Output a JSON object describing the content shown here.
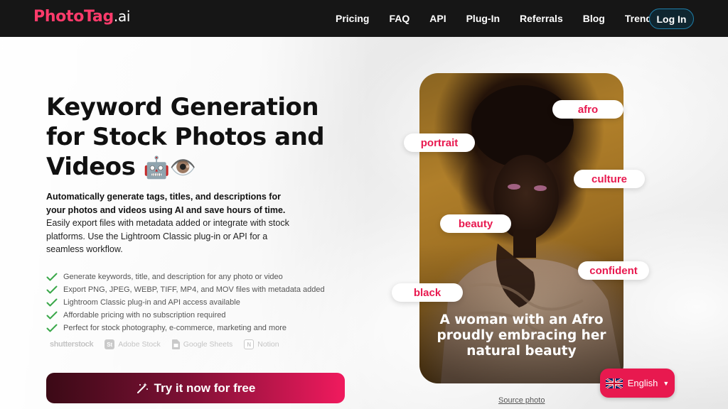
{
  "nav": {
    "logo_main": "PhotoTag",
    "logo_suffix": ".ai",
    "links": [
      "Pricing",
      "FAQ",
      "API",
      "Plug-In",
      "Referrals",
      "Blog",
      "Trends"
    ],
    "login_label": "Log In"
  },
  "hero": {
    "title": "Keyword Generation for Stock Photos and Videos",
    "title_emoji": "🤖👁️",
    "desc_bold": "Automatically generate tags, titles, and descriptions for your photos and videos using AI and save hours of time.",
    "desc_rest": "Easily export files with metadata added or integrate with stock platforms. Use the Lightroom Classic plug-in or API for a seamless workflow.",
    "features": [
      "Generate keywords, title, and description for any photo or video",
      "Export PNG, JPEG, WEBP, TIFF, MP4, and MOV files with metadata added",
      "Lightroom Classic plug-in and API access available",
      "Affordable pricing with no subscription required",
      "Perfect for stock photography, e-commerce, marketing and more"
    ],
    "partners": {
      "shutterstock": "shutterstock",
      "adobe_stock": "Adobe Stock",
      "adobe_badge": "St",
      "google_sheets": "Google Sheets",
      "notion": "Notion",
      "notion_badge": "N"
    },
    "cta_label": "Try it now for free"
  },
  "photo": {
    "caption": "A woman with an Afro proudly embracing her natural beauty",
    "tags": {
      "afro": "afro",
      "portrait": "portrait",
      "culture": "culture",
      "beauty": "beauty",
      "confident": "confident",
      "black": "black"
    },
    "source_label": "Source photo"
  },
  "language": {
    "current": "English",
    "flag_icon": "uk-flag-icon"
  },
  "colors": {
    "brand": "#ff3b6b",
    "tag_text": "#e8194f",
    "nav_bg": "#161616",
    "check": "#3aa84a"
  }
}
